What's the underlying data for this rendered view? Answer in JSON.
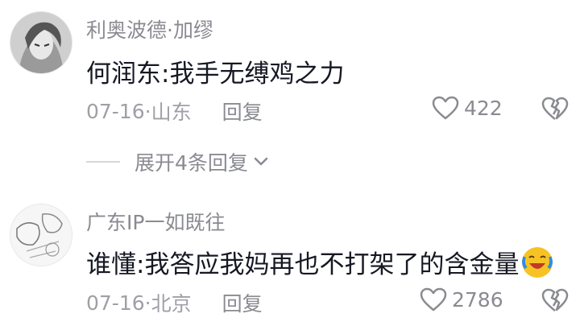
{
  "comments": [
    {
      "username": "利奥波德·加缪",
      "text": "何润东:我手无缚鸡之力",
      "date": "07-16",
      "location": "山东",
      "reply_label": "回复",
      "likes": "422",
      "expand_label": "展开4条回复"
    },
    {
      "username": "广东IP一如既往",
      "text": "谁懂:我答应我妈再也不打架了的含金量",
      "emoji": "laughing-crying-emoji",
      "date": "07-16",
      "location": "北京",
      "reply_label": "回复",
      "likes": "2786"
    }
  ],
  "separator": " · ",
  "colors": {
    "primary_text": "#161823",
    "secondary_text": "#8a8b91",
    "meta_text": "#9fa0a6"
  }
}
